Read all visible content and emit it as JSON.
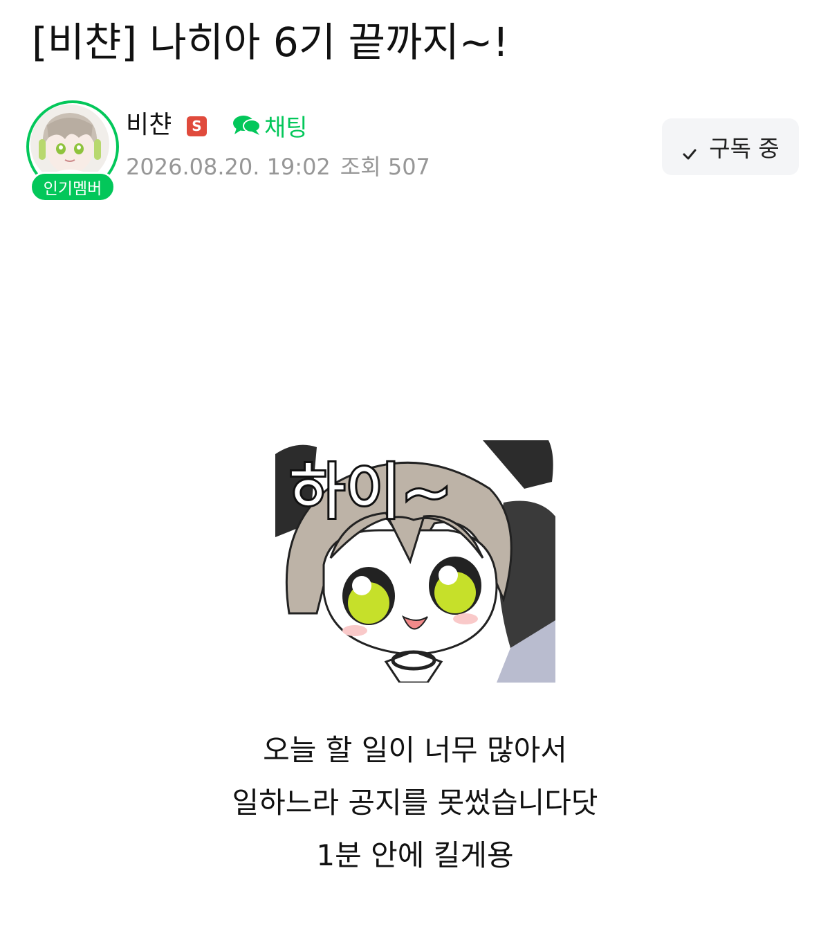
{
  "post": {
    "title": "[비챤] 나히아 6기 끝까지~!",
    "body_lines": [
      "오늘 할 일이 너무 많아서",
      "일하느라 공지를 못썼습니다닷",
      "1분 안에 킬게용"
    ]
  },
  "author": {
    "name": "비챤",
    "staff_badge": "S",
    "popular_badge": "인기멤버",
    "avatar_icon": "anime-character-avatar"
  },
  "chat": {
    "label": "채팅",
    "icon": "speech-bubbles-icon"
  },
  "meta": {
    "datetime": "2026.08.20. 19:02",
    "views": "조회 507"
  },
  "subscribe": {
    "label": "구독 중",
    "icon": "check-icon"
  },
  "sticker": {
    "text": "하이~"
  },
  "colors": {
    "accent_green": "#03c75a",
    "staff_red": "#e04a3c",
    "meta_gray": "#979797",
    "button_bg": "#f4f5f7"
  }
}
